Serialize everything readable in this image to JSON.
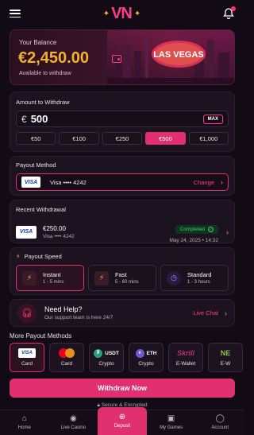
{
  "header": {
    "logo": "VN",
    "menu_icon": "hamburger-icon",
    "bell_icon": "bell-icon"
  },
  "balance": {
    "label": "Your Balance",
    "amount": "€2,450.00",
    "sub": "Available to withdraw",
    "image_text": "LAS VEGAS"
  },
  "withdraw": {
    "title": "Amount to Withdraw",
    "currency": "€",
    "value": "500",
    "max_label": "MAX",
    "chips": [
      "€50",
      "€100",
      "€250",
      "€500",
      "€1,000"
    ],
    "selected_chip": "€500"
  },
  "payout_method": {
    "title": "Payout Method",
    "card": "Visa •••• 4242",
    "change": "Change",
    "brand": "VISA"
  },
  "recent": {
    "title": "Recent Withdrawal",
    "amount": "€250.00",
    "card": "Visa •••• 4242",
    "status": "Completed",
    "date": "May 24, 2025 • 14:32"
  },
  "speed": {
    "title": "Payout Speed",
    "options": [
      {
        "name": "Instant",
        "time": "1 - 5 mins"
      },
      {
        "name": "Fast",
        "time": "5 - 60 mins"
      },
      {
        "name": "Standard",
        "time": "1 - 3 hours"
      }
    ]
  },
  "help": {
    "title": "Need Help?",
    "sub": "Our support team is here 24/7",
    "live": "Live Chat"
  },
  "more": {
    "title": "More Payout Methods",
    "methods": [
      {
        "logo": "VISA",
        "label": "Card"
      },
      {
        "logo": "mastercard",
        "label": "Card"
      },
      {
        "logo": "USDT",
        "label": "Crypto"
      },
      {
        "logo": "ETH",
        "label": "Crypto"
      },
      {
        "logo": "Skrill",
        "label": "E-Wallet"
      },
      {
        "logo": "NE",
        "label": "E-W"
      }
    ]
  },
  "cta": {
    "label": "Withdraw Now",
    "secure": "Secure & Encrypted"
  },
  "nav": [
    {
      "label": "Home"
    },
    {
      "label": "Live Casino"
    },
    {
      "label": "Deposit"
    },
    {
      "label": "My Games"
    },
    {
      "label": "Account"
    }
  ],
  "colors": {
    "accent": "#e0306f",
    "gold": "#f5b030",
    "success": "#35d07f"
  }
}
